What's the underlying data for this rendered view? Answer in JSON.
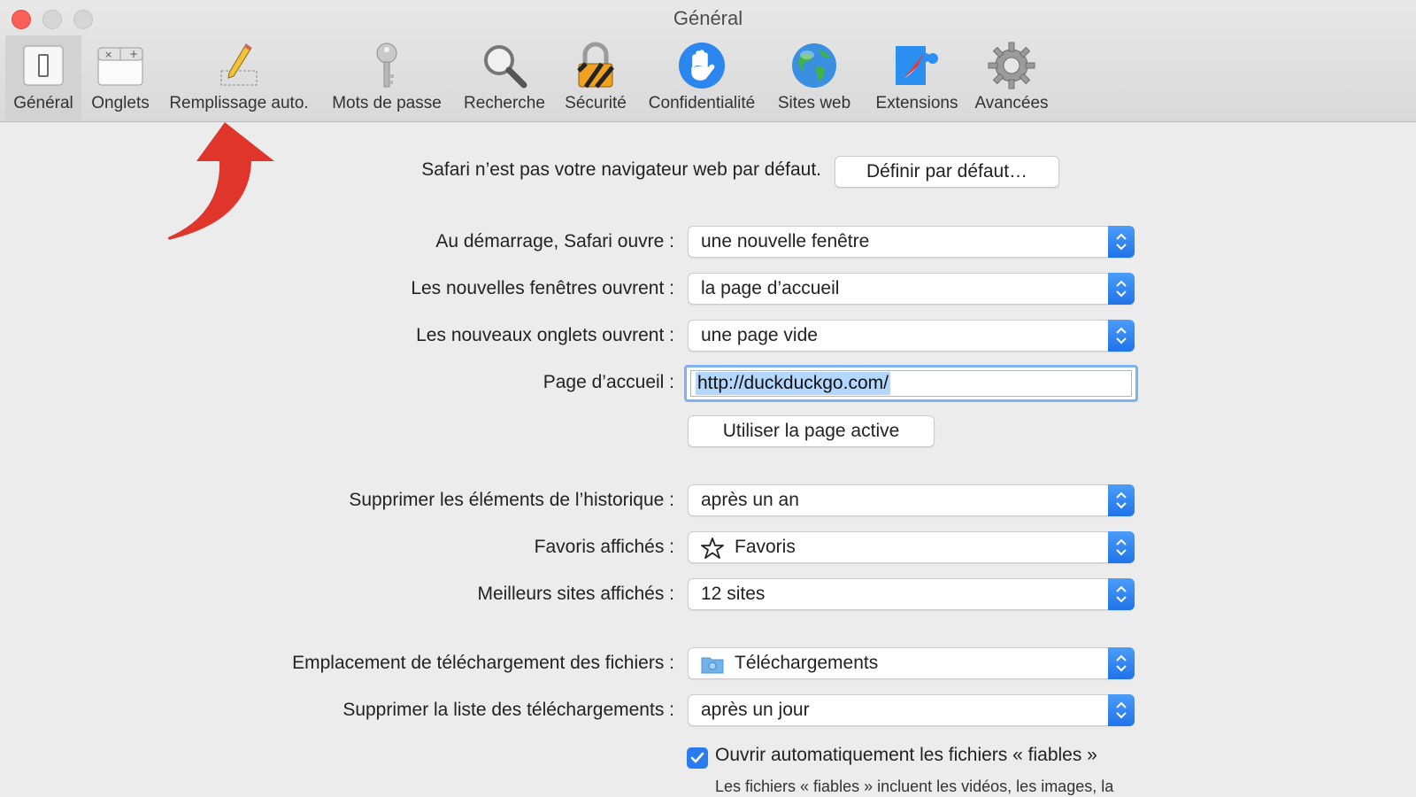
{
  "window": {
    "title": "Général"
  },
  "toolbar": {
    "tabs": [
      {
        "label": "Général",
        "icon": "switch-icon"
      },
      {
        "label": "Onglets",
        "icon": "tabs-icon"
      },
      {
        "label": "Remplissage auto.",
        "icon": "pencil-icon"
      },
      {
        "label": "Mots de passe",
        "icon": "key-icon"
      },
      {
        "label": "Recherche",
        "icon": "magnifier-icon"
      },
      {
        "label": "Sécurité",
        "icon": "padlock-icon"
      },
      {
        "label": "Confidentialité",
        "icon": "hand-icon"
      },
      {
        "label": "Sites web",
        "icon": "globe-icon"
      },
      {
        "label": "Extensions",
        "icon": "puzzle-compass-icon"
      },
      {
        "label": "Avancées",
        "icon": "gear-icon"
      }
    ],
    "active_tab": "Général"
  },
  "default_browser": {
    "message": "Safari n’est pas votre navigateur web par défaut.",
    "button_label": "Définir par défaut…"
  },
  "settings": {
    "startup": {
      "label": "Au démarrage, Safari ouvre :",
      "value": "une nouvelle fenêtre"
    },
    "new_windows": {
      "label": "Les nouvelles fenêtres ouvrent :",
      "value": "la page d’accueil"
    },
    "new_tabs": {
      "label": "Les nouveaux onglets ouvrent :",
      "value": "une page vide"
    },
    "homepage": {
      "label": "Page d’accueil :",
      "value": "http://duckduckgo.com/"
    },
    "use_current_page_label": "Utiliser la page active",
    "history": {
      "label": "Supprimer les éléments de l’historique :",
      "value": "après un an"
    },
    "favorites": {
      "label": "Favoris affichés :",
      "value": "Favoris",
      "icon": "star-icon"
    },
    "top_sites": {
      "label": "Meilleurs sites affichés :",
      "value": "12 sites"
    },
    "download_location": {
      "label": "Emplacement de téléchargement des fichiers :",
      "value": "Téléchargements",
      "icon": "folder-icon"
    },
    "download_list": {
      "label": "Supprimer la liste des téléchargements :",
      "value": "après un jour"
    },
    "open_safe_files": {
      "label": "Ouvrir automatiquement les fichiers « fiables »",
      "checked": true,
      "description": "Les fichiers « fiables » incluent les vidéos, les images, la"
    }
  },
  "colors": {
    "accent": "#2a7bf0",
    "close": "#fc5f57",
    "annotation_arrow": "#e0352b"
  }
}
